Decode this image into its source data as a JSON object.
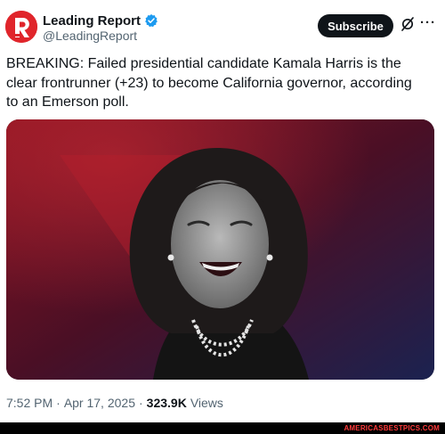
{
  "account": {
    "display_name": "Leading Report",
    "handle": "@LeadingReport",
    "avatar_icon": "leading-report-logo",
    "brand_color": "#e0252b",
    "verified_color": "#1d9bf0"
  },
  "actions": {
    "subscribe_label": "Subscribe",
    "grok_icon": "grok-icon",
    "more_icon": "more-options-icon",
    "more_glyph": "···"
  },
  "tweet": {
    "text": "BREAKING: Failed presidential candidate Kamala Harris is the clear frontrunner (+23) to become California governor, according to an Emerson poll."
  },
  "media": {
    "description_icon": "photo",
    "background_colors": [
      "#6a0f1c",
      "#1c2350"
    ]
  },
  "meta": {
    "time": "7:52 PM",
    "separator": "·",
    "date": "Apr 17, 2025",
    "views_count": "323.9K",
    "views_label": "Views"
  },
  "watermark": {
    "text": "AMERICASBESTPICS.COM"
  }
}
